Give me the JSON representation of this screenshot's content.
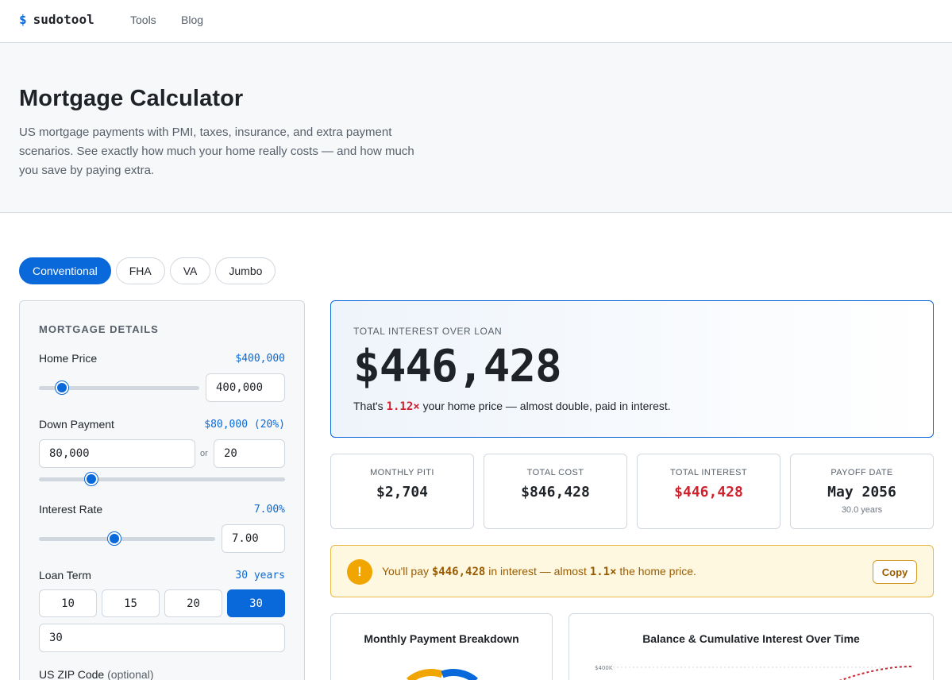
{
  "brand": {
    "symbol": "$",
    "name": "sudotool"
  },
  "nav": {
    "tools": "Tools",
    "blog": "Blog"
  },
  "hero": {
    "title": "Mortgage Calculator",
    "description": "US mortgage payments with PMI, taxes, insurance, and extra payment scenarios. See exactly how much your home really costs — and how much you save by paying extra."
  },
  "loan_types": [
    {
      "label": "Conventional",
      "active": true
    },
    {
      "label": "FHA",
      "active": false
    },
    {
      "label": "VA",
      "active": false
    },
    {
      "label": "Jumbo",
      "active": false
    }
  ],
  "details": {
    "title": "MORTGAGE DETAILS",
    "home_price": {
      "label": "Home Price",
      "display": "$400,000",
      "input": "400,000",
      "slider_fraction": 0.13
    },
    "down_payment": {
      "label": "Down Payment",
      "display": "$80,000 (20%)",
      "input": "80,000",
      "or": "or",
      "percent_input": "20",
      "slider_fraction": 0.2
    },
    "interest_rate": {
      "label": "Interest Rate",
      "display": "7.00%",
      "input": "7.00",
      "slider_fraction": 0.43
    },
    "loan_term": {
      "label": "Loan Term",
      "display": "30 years",
      "options": [
        "10",
        "15",
        "20",
        "30"
      ],
      "selected": "30",
      "input": "30"
    },
    "zip": {
      "label": "US ZIP Code",
      "optional": "(optional)"
    }
  },
  "result": {
    "label": "TOTAL INTEREST OVER LOAN",
    "value": "$446,428",
    "sub_prefix": "That's ",
    "multiplier": "1.12×",
    "sub_suffix": " your home price — almost double, paid in interest."
  },
  "stats": [
    {
      "label": "MONTHLY PITI",
      "value": "$2,704",
      "sub": "",
      "red": false
    },
    {
      "label": "TOTAL COST",
      "value": "$846,428",
      "sub": "",
      "red": false
    },
    {
      "label": "TOTAL INTEREST",
      "value": "$446,428",
      "sub": "",
      "red": true
    },
    {
      "label": "PAYOFF DATE",
      "value": "May 2056",
      "sub": "30.0 years",
      "red": false
    }
  ],
  "warning": {
    "icon": "exclamation-icon",
    "prefix": "You'll pay ",
    "amount": "$446,428",
    "middle": " in interest — almost ",
    "multiplier": "1.1×",
    "suffix": " the home price.",
    "copy_label": "Copy"
  },
  "charts": {
    "breakdown_title": "Monthly Payment Breakdown",
    "balance_title": "Balance & Cumulative Interest Over Time",
    "balance_axis_label": "$400K"
  },
  "colors": {
    "accent": "#0969da",
    "danger": "#cf222e",
    "warning": "#f0a500"
  }
}
